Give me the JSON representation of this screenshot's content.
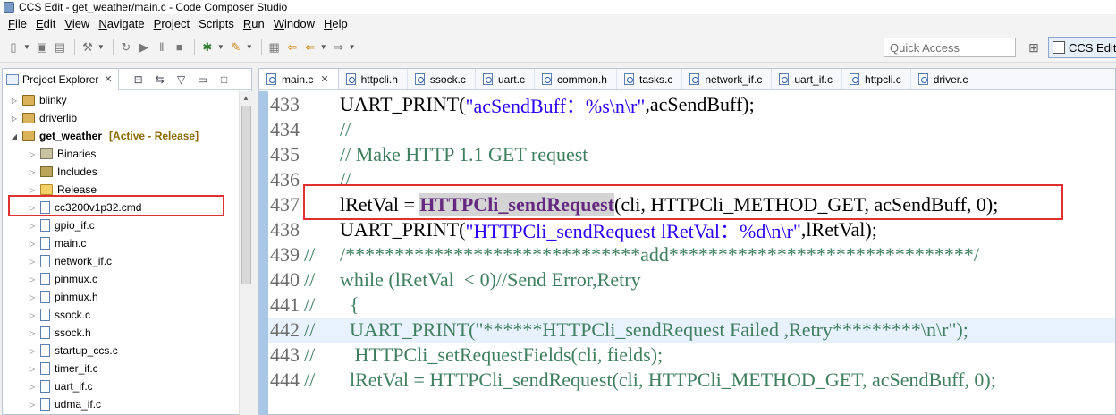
{
  "window": {
    "title": "CCS Edit - get_weather/main.c - Code Composer Studio"
  },
  "menu": [
    {
      "label": "File",
      "u": "F",
      "rest": "ile"
    },
    {
      "label": "Edit",
      "u": "E",
      "rest": "dit"
    },
    {
      "label": "View",
      "u": "V",
      "rest": "iew"
    },
    {
      "label": "Navigate",
      "u": "N",
      "rest": "avigate"
    },
    {
      "label": "Project",
      "u": "P",
      "rest": "roject"
    },
    {
      "label": "Scripts",
      "u": "",
      "rest": "Scripts"
    },
    {
      "label": "Run",
      "u": "R",
      "rest": "un"
    },
    {
      "label": "Window",
      "u": "W",
      "rest": "indow"
    },
    {
      "label": "Help",
      "u": "H",
      "rest": "elp"
    }
  ],
  "toolbar": {
    "quick_access_placeholder": "Quick Access",
    "perspective_label": "CCS Edit"
  },
  "explorer": {
    "tab_label": "Project Explorer",
    "close": "✕",
    "projects": [
      {
        "name": "blinky",
        "arrow": "▷"
      },
      {
        "name": "driverlib",
        "arrow": "▷"
      },
      {
        "name": "get_weather",
        "arrow": "◢",
        "status": "[Active - Release]"
      }
    ],
    "children": [
      {
        "name": "Binaries",
        "kind": "bin"
      },
      {
        "name": "Includes",
        "kind": "lib"
      },
      {
        "name": "Release",
        "kind": "folder"
      },
      {
        "name": "cc3200v1p32.cmd",
        "kind": "file"
      },
      {
        "name": "gpio_if.c",
        "kind": "file"
      },
      {
        "name": "main.c",
        "kind": "file"
      },
      {
        "name": "network_if.c",
        "kind": "file"
      },
      {
        "name": "pinmux.c",
        "kind": "file"
      },
      {
        "name": "pinmux.h",
        "kind": "file"
      },
      {
        "name": "ssock.c",
        "kind": "file"
      },
      {
        "name": "ssock.h",
        "kind": "file"
      },
      {
        "name": "startup_ccs.c",
        "kind": "file"
      },
      {
        "name": "timer_if.c",
        "kind": "file"
      },
      {
        "name": "uart_if.c",
        "kind": "file"
      },
      {
        "name": "udma_if.c",
        "kind": "file"
      }
    ]
  },
  "editor": {
    "tabs": [
      {
        "label": "main.c",
        "active": true
      },
      {
        "label": "httpcli.h"
      },
      {
        "label": "ssock.c"
      },
      {
        "label": "uart.c"
      },
      {
        "label": "common.h"
      },
      {
        "label": "tasks.c"
      },
      {
        "label": "network_if.c"
      },
      {
        "label": "uart_if.c"
      },
      {
        "label": "httpcli.c"
      },
      {
        "label": "driver.c"
      }
    ],
    "lines": [
      {
        "num": "433",
        "gutter": "",
        "segments": [
          {
            "t": "    UART_PRINT(",
            "c": "code"
          },
          {
            "t": "\"acSendBuff：%s\\n\\r\"",
            "c": "str"
          },
          {
            "t": ",acSendBuff);",
            "c": "code"
          }
        ]
      },
      {
        "num": "434",
        "gutter": "",
        "segments": [
          {
            "t": "    //",
            "c": "cmt"
          }
        ]
      },
      {
        "num": "435",
        "gutter": "",
        "segments": [
          {
            "t": "    // Make HTTP 1.1 GET request",
            "c": "cmt"
          }
        ]
      },
      {
        "num": "436",
        "gutter": "",
        "segments": [
          {
            "t": "    //",
            "c": "cmt"
          }
        ]
      },
      {
        "num": "437",
        "gutter": "",
        "segments": [
          {
            "t": "    lRetVal = ",
            "c": "code"
          },
          {
            "t": "HTTPCli_sendRequest",
            "c": "fn-strong"
          },
          {
            "t": "(cli, HTTPCli_METHOD_GET, acSendBuff, 0);",
            "c": "code"
          }
        ]
      },
      {
        "num": "438",
        "gutter": "",
        "segments": [
          {
            "t": "    UART_PRINT(",
            "c": "code"
          },
          {
            "t": "\"HTTPCli_sendRequest lRetVal：%d\\n\\r\"",
            "c": "str"
          },
          {
            "t": ",lRetVal);",
            "c": "code"
          }
        ]
      },
      {
        "num": "439",
        "gutter": "//",
        "segments": [
          {
            "t": "    /******************************add*******************************/",
            "c": "cmt"
          }
        ]
      },
      {
        "num": "440",
        "gutter": "//",
        "segments": [
          {
            "t": "    while (lRetVal  < 0)//Send Error,Retry",
            "c": "cmt"
          }
        ]
      },
      {
        "num": "441",
        "gutter": "//",
        "segments": [
          {
            "t": "      {",
            "c": "cmt"
          }
        ]
      },
      {
        "num": "442",
        "gutter": "//",
        "highlight": true,
        "segments": [
          {
            "t": "      UART_PRINT(\"******HTTPCli_sendRequest Failed ,Retry*********\\n\\r\");",
            "c": "cmt"
          }
        ]
      },
      {
        "num": "443",
        "gutter": "//",
        "segments": [
          {
            "t": "       HTTPCli_setRequestFields(cli, fields);",
            "c": "cmt"
          }
        ]
      },
      {
        "num": "444",
        "gutter": "//",
        "segments": [
          {
            "t": "      lRetVal = HTTPCli_sendRequest(cli, HTTPCli_METHOD_GET, acSendBuff, 0);",
            "c": "cmt"
          }
        ]
      }
    ]
  },
  "colors": {
    "annotation_red": "#e03030",
    "string_blue": "#2a00ff",
    "comment_green": "#3f7f5f",
    "line_highlight": "#e8f2fe"
  }
}
